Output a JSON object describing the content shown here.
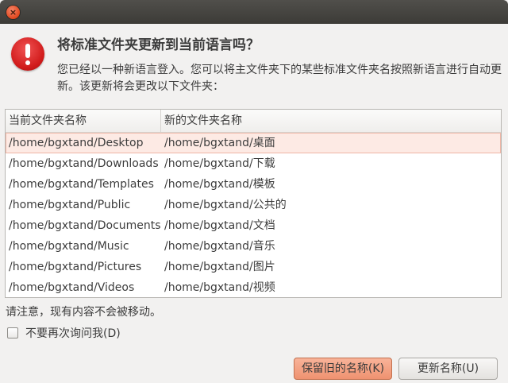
{
  "titlebar": {
    "close_glyph": "×",
    "close_icon": "close-icon"
  },
  "dialog": {
    "icon": "warning-icon",
    "heading": "将标准文件夹更新到当前语言吗？",
    "description": "您已经以一种新语言登入。您可以将主文件夹下的某些标准文件夹名按照新语言进行自动更新。该更新将会更改以下文件夹："
  },
  "table": {
    "columns": [
      "当前文件夹名称",
      "新的文件夹名称"
    ],
    "rows": [
      {
        "current": "/home/bgxtand/Desktop",
        "new": "/home/bgxtand/桌面",
        "selected": true
      },
      {
        "current": "/home/bgxtand/Downloads",
        "new": "/home/bgxtand/下载"
      },
      {
        "current": "/home/bgxtand/Templates",
        "new": "/home/bgxtand/模板"
      },
      {
        "current": "/home/bgxtand/Public",
        "new": "/home/bgxtand/公共的"
      },
      {
        "current": "/home/bgxtand/Documents",
        "new": "/home/bgxtand/文档"
      },
      {
        "current": "/home/bgxtand/Music",
        "new": "/home/bgxtand/音乐"
      },
      {
        "current": "/home/bgxtand/Pictures",
        "new": "/home/bgxtand/图片"
      },
      {
        "current": "/home/bgxtand/Videos",
        "new": "/home/bgxtand/视频"
      }
    ]
  },
  "note": "请注意，现有内容不会被移动。",
  "checkbox": {
    "label": "不要再次询问我(D)",
    "checked": false
  },
  "buttons": {
    "keep_label": "保留旧的名称(K)",
    "update_label": "更新名称(U)"
  },
  "colors": {
    "titlebar": "#3c3b37",
    "close_button": "#e0471d",
    "accent_button": "#ef9270",
    "selected_row": "#fdeae4"
  }
}
